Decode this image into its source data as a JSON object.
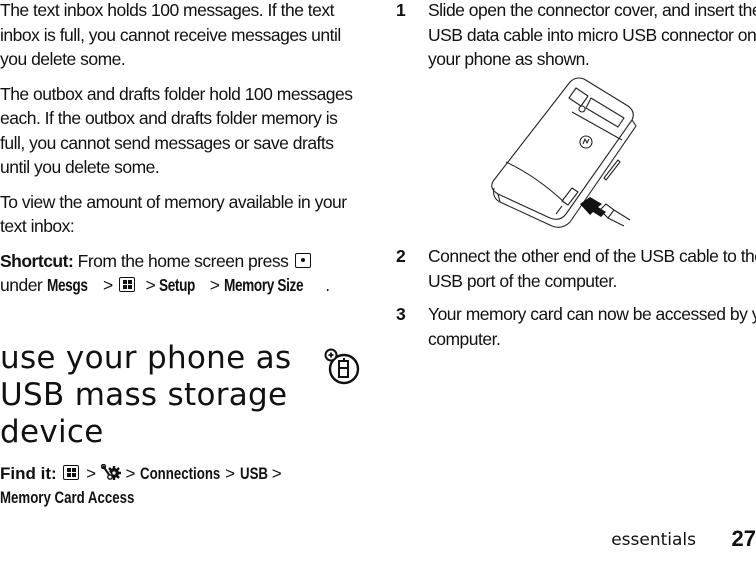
{
  "left_column": {
    "paragraphs": [
      "The text inbox holds 100 messages. If the text inbox is full, you cannot receive messages until you delete some.",
      "The outbox and drafts folder hold 100 messages each. If the outbox and drafts folder memory is full, you cannot send messages or save drafts until you delete some.",
      "To view the amount of memory available in your text inbox:"
    ],
    "shortcut": {
      "label": "Shortcut:",
      "text_before": "From the home screen press",
      "key_icon": "center-select-key-icon",
      "text_under": "under",
      "path": [
        "Mesgs",
        "Memory Size"
      ],
      "menu_icon": "menu-key-icon",
      "setup": "Setup",
      "separator": ">"
    }
  },
  "section": {
    "title": "use your phone as USB mass storage device",
    "feature_icon": "network-feature-phone-icon",
    "find_it": {
      "label": "Find it:",
      "menu_icon": "menu-key-icon",
      "settings_icon": "settings-wrench-gear-icon",
      "path": [
        "Connections",
        "USB",
        "Memory Card Access"
      ],
      "separator": ">"
    }
  },
  "right_column": {
    "steps": [
      {
        "number": "1",
        "text": "Slide open the connector cover, and insert the USB data cable into micro USB connector on your phone as shown."
      },
      {
        "number": "2",
        "text": "Connect the other end of the USB cable to the USB port of the computer."
      },
      {
        "number": "3",
        "text": "Your memory card can now be accessed by your computer."
      }
    ],
    "figure": "phone-usb-connection-illustration"
  },
  "footer": {
    "section_name": "essentials",
    "page_number": "27"
  }
}
